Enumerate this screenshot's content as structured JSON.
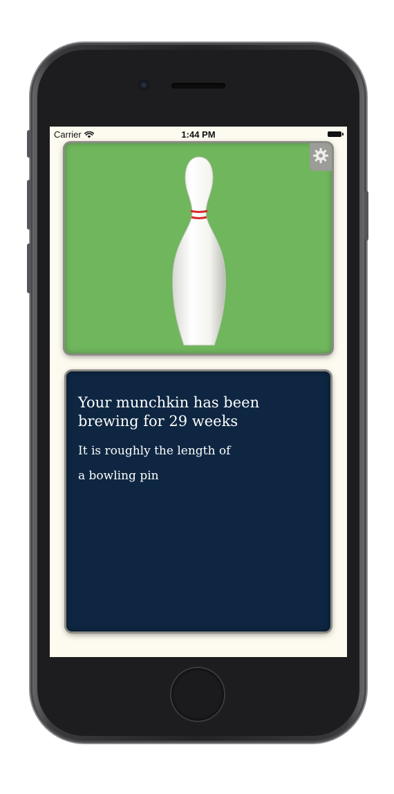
{
  "status_bar": {
    "carrier": "Carrier",
    "time": "1:44 PM"
  },
  "image_card": {
    "subject": "bowling pin",
    "background_color": "#6fb65d",
    "settings_icon": "gear-icon"
  },
  "info_card": {
    "background_color": "#0e2641",
    "heading": "Your munchkin has been brewing for 29 weeks",
    "line1": "It is roughly the length of",
    "line2": "a bowling pin"
  },
  "colors": {
    "screen_background": "#fdfbf0",
    "pin_stripe": "#d9262b"
  }
}
